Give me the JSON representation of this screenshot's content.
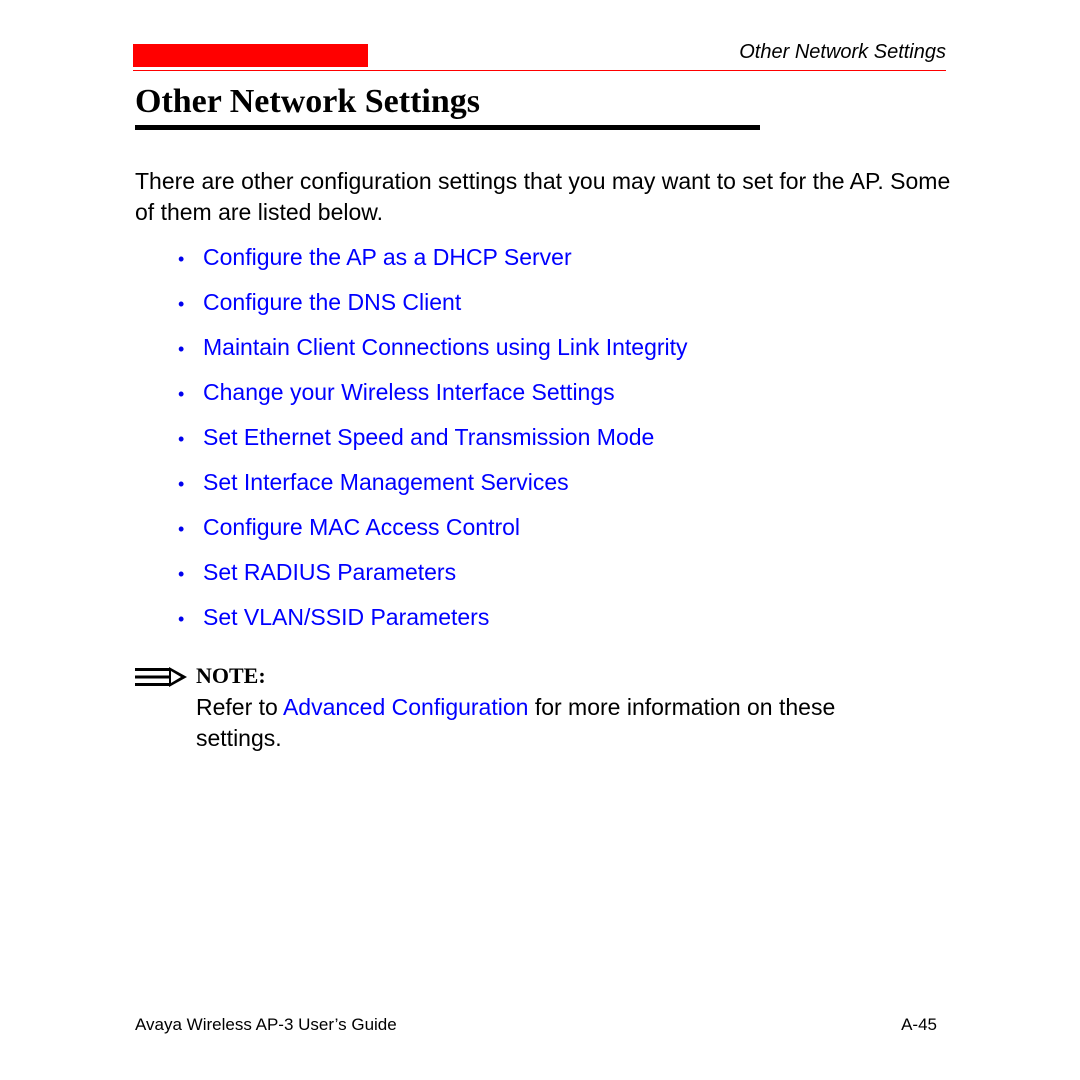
{
  "header": {
    "running_title": "Other Network Settings",
    "accent_color": "#ff0000"
  },
  "page": {
    "title": "Other Network Settings",
    "intro": "There are other configuration settings that you may want to set for the AP. Some of them are listed below.",
    "link_color": "#0000ff",
    "bullet_items": [
      {
        "label": "Configure the AP as a DHCP Server"
      },
      {
        "label": "Configure the DNS Client"
      },
      {
        "label": "Maintain Client Connections using Link Integrity"
      },
      {
        "label": "Change your Wireless Interface Settings"
      },
      {
        "label": "Set Ethernet Speed and Transmission Mode"
      },
      {
        "label": "Set Interface Management Services"
      },
      {
        "label": "Configure MAC Access Control"
      },
      {
        "label": "Set RADIUS Parameters"
      },
      {
        "label": "Set VLAN/SSID Parameters"
      }
    ],
    "bullet_glyph": "•"
  },
  "note": {
    "icon": "note-arrow-icon",
    "label": "NOTE:",
    "text_before": "Refer to ",
    "link_text": "Advanced Configuration",
    "text_after": " for more information on these settings."
  },
  "footer": {
    "guide_title": "Avaya Wireless AP-3 User’s Guide",
    "page_number": "A-45"
  }
}
